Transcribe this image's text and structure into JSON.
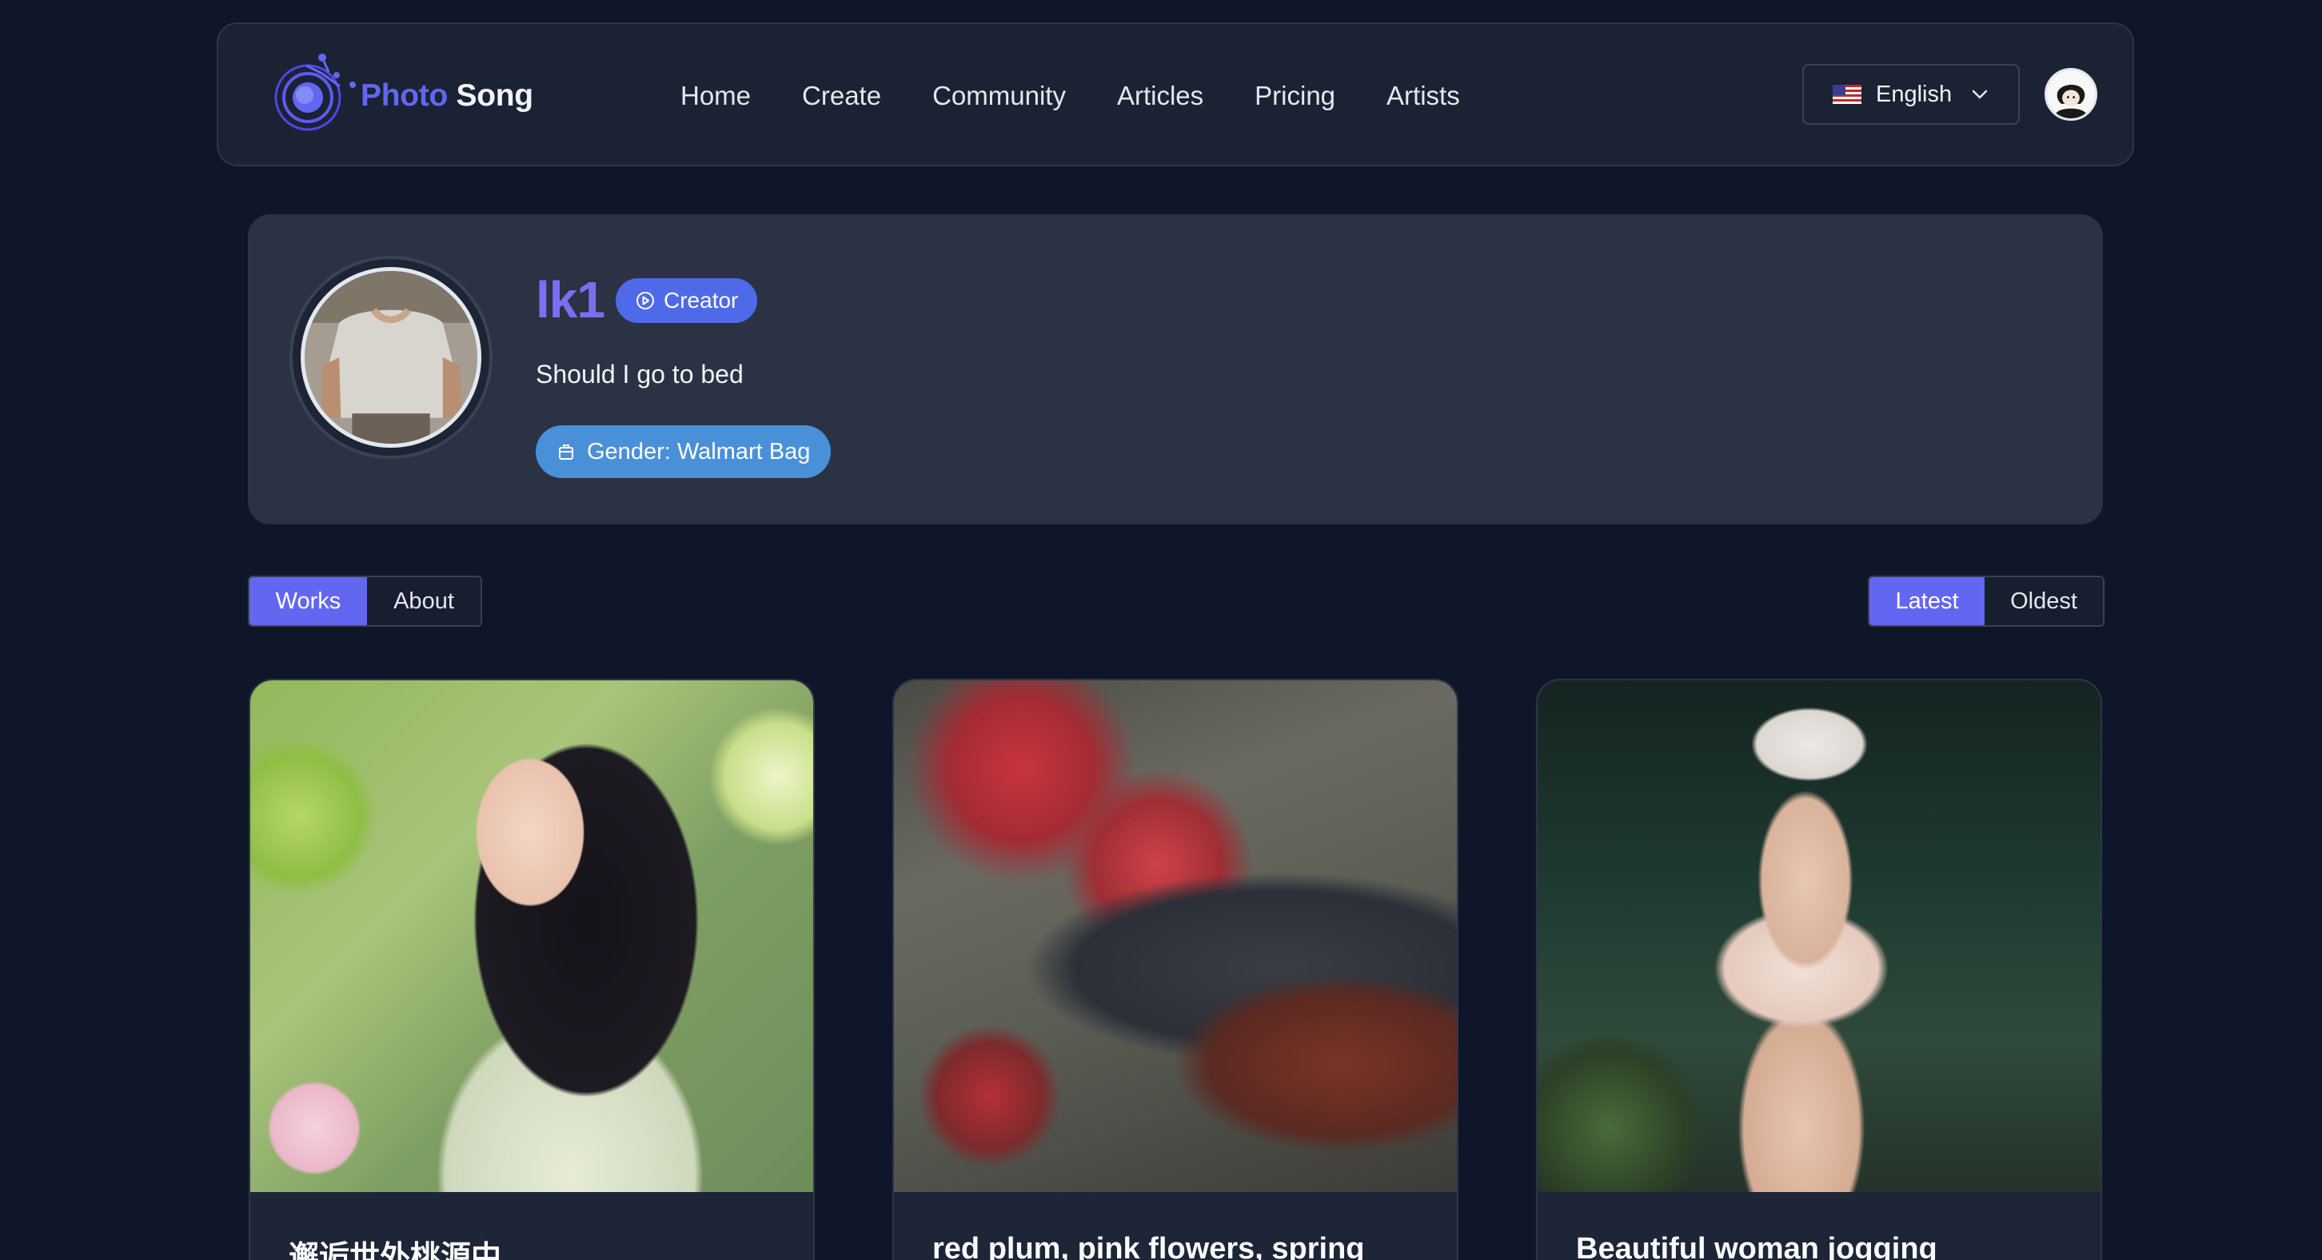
{
  "brand": {
    "part1": "Photo",
    "part2": "Song"
  },
  "nav": {
    "links": [
      "Home",
      "Create",
      "Community",
      "Articles",
      "Pricing",
      "Artists"
    ]
  },
  "language": {
    "label": "English",
    "flag_icon": "us-flag-icon"
  },
  "profile": {
    "username": "lk1",
    "badge": "Creator",
    "bio": "Should I go to bed",
    "gender_tag": "Gender: Walmart Bag"
  },
  "tabs": {
    "works": "Works",
    "about": "About",
    "active": "Works"
  },
  "sort": {
    "latest": "Latest",
    "oldest": "Oldest",
    "active": "Latest"
  },
  "works": [
    {
      "title": "邂逅世外桃源中"
    },
    {
      "title": "red plum, pink flowers, spring"
    },
    {
      "title": "Beautiful woman jogging"
    }
  ],
  "colors": {
    "background": "#0f1629",
    "accent": "#6366f1",
    "creator_badge": "#4f6ae8",
    "gender_badge": "#4a90d9",
    "username": "#7c6ef0"
  }
}
